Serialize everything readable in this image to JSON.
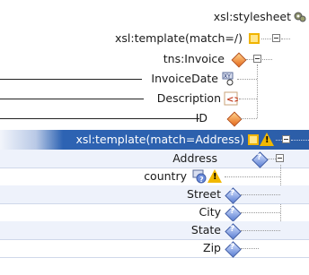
{
  "tree": {
    "stylesheet": {
      "label": "xsl:stylesheet",
      "icon": "stylesheet-icon"
    },
    "template_root": {
      "label": "xsl:template(match=/)",
      "icon": "template-icon"
    },
    "invoice": {
      "label": "tns:Invoice",
      "icon": "element-diamond-icon"
    },
    "invoice_date": {
      "label": "InvoiceDate",
      "icon": "xy-type-icon"
    },
    "description": {
      "label": "Description",
      "icon": "element-bracket-icon"
    },
    "id": {
      "label": "ID",
      "icon": "element-diamond-icon"
    },
    "template_address": {
      "label": "xsl:template(match=Address)",
      "icon": "template-icon",
      "warning": "warning-icon"
    },
    "address": {
      "label": "Address",
      "icon": "unresolved-element-icon"
    },
    "country": {
      "label": "country",
      "icon": "unresolved-type-icon",
      "warning": "warning-icon"
    },
    "street": {
      "label": "Street",
      "icon": "unresolved-element-icon"
    },
    "city": {
      "label": "City",
      "icon": "unresolved-element-icon"
    },
    "state": {
      "label": "State",
      "icon": "unresolved-element-icon"
    },
    "zip": {
      "label": "Zip",
      "icon": "unresolved-element-icon"
    }
  },
  "colors": {
    "selection": "#2c5ea8",
    "band": "#eef2fb",
    "warning": "#f1b800",
    "diamond": "#e56a1c",
    "unresolved": "#5b7fd3"
  }
}
